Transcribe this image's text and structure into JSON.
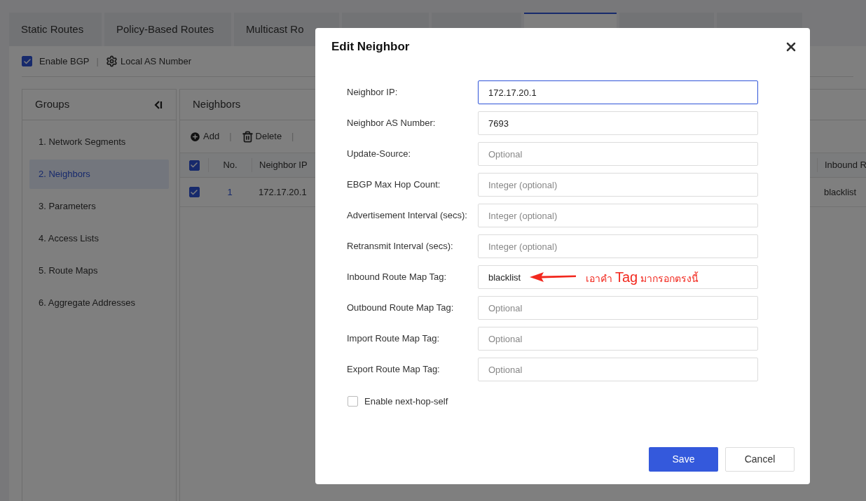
{
  "tabs": [
    {
      "label": "Static Routes",
      "selected": false
    },
    {
      "label": "Policy-Based Routes",
      "selected": false
    },
    {
      "label": "Multicast Ro",
      "selected": false
    },
    {
      "selected": false
    },
    {
      "selected": false
    },
    {
      "selected": true
    },
    {
      "selected": false
    },
    {
      "selected": false
    }
  ],
  "toolbar": {
    "enable_bgp": {
      "label": "Enable BGP",
      "checked": true
    },
    "separator": "|",
    "local_as": "Local AS Number"
  },
  "groups": {
    "title": "Groups",
    "items": [
      {
        "label": "1. Network Segments",
        "selected": false
      },
      {
        "label": "2. Neighbors",
        "selected": true
      },
      {
        "label": "3. Parameters",
        "selected": false
      },
      {
        "label": "4. Access Lists",
        "selected": false
      },
      {
        "label": "5. Route Maps",
        "selected": false
      },
      {
        "label": "6. Aggregate Addresses",
        "selected": false
      }
    ]
  },
  "neighbors": {
    "title": "Neighbors",
    "actions": [
      {
        "label": "Add",
        "kind": "add",
        "separator": "|"
      },
      {
        "label": "Delete",
        "kind": "delete",
        "separator": "|"
      }
    ],
    "columns": [
      "No.",
      "Neighbor IP",
      "Inbound R"
    ],
    "header_checked": true,
    "rows": [
      {
        "checked": true,
        "cells": [
          "1",
          "172.17.20.1",
          "blacklist"
        ]
      }
    ]
  },
  "dialog": {
    "title": "Edit Neighbor",
    "fields": [
      {
        "label": "Neighbor IP:",
        "value": "172.17.20.1",
        "focused": true
      },
      {
        "label": "Neighbor AS Number:",
        "value": "7693",
        "focused": false
      },
      {
        "label": "Update-Source:",
        "placeholder": "Optional",
        "focused": false
      },
      {
        "label": "EBGP Max Hop Count:",
        "placeholder": "Integer (optional)",
        "focused": false
      },
      {
        "label": "Advertisement Interval (secs):",
        "placeholder": "Integer (optional)",
        "focused": false
      },
      {
        "label": "Retransmit Interval (secs):",
        "placeholder": "Integer (optional)",
        "focused": false
      },
      {
        "label": "Inbound Route Map Tag:",
        "value": "blacklist",
        "focused": false,
        "annotation": {
          "before": "เอาคำ",
          "emphasis": "Tag",
          "after": "มากรอกตรงนี้"
        }
      },
      {
        "label": "Outbound Route Map Tag:",
        "placeholder": "Optional",
        "focused": false
      },
      {
        "label": "Import Route Map Tag:",
        "placeholder": "Optional",
        "focused": false
      },
      {
        "label": "Export Route Map Tag:",
        "placeholder": "Optional",
        "focused": false
      }
    ],
    "next_hop_self": {
      "label": "Enable next-hop-self",
      "checked": false
    },
    "buttons": [
      {
        "label": "Save",
        "kind": "primary"
      },
      {
        "label": "Cancel",
        "kind": "secondary"
      }
    ]
  }
}
